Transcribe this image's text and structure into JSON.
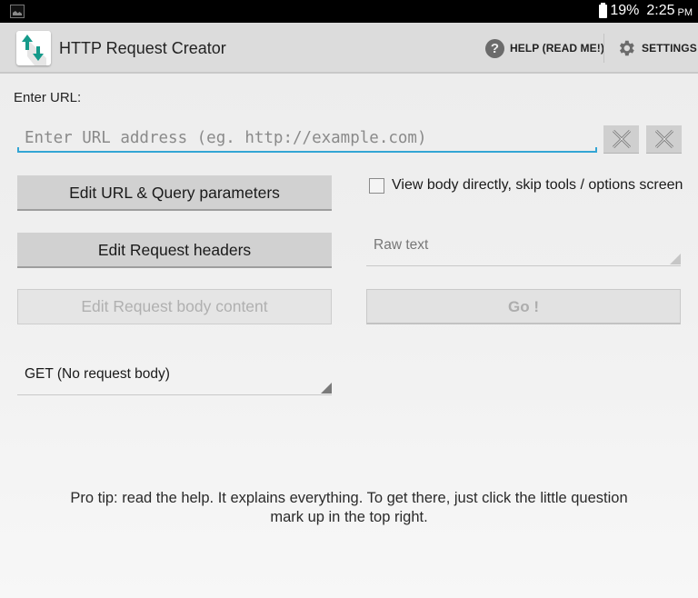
{
  "status_bar": {
    "notification_icon": "gallery-icon",
    "battery_icon": "battery-icon",
    "battery_percent": "19%",
    "time": "2:25",
    "ampm": "PM"
  },
  "action_bar": {
    "app_icon": "up-down-arrows-icon",
    "title": "HTTP Request Creator",
    "help": {
      "icon": "help-circle-icon",
      "label": "HELP (READ ME!)"
    },
    "settings": {
      "icon": "gear-icon",
      "label": "SETTINGS"
    }
  },
  "url": {
    "label": "Enter URL:",
    "value": "",
    "placeholder": "Enter URL address (eg. http://example.com)",
    "clear_buttons": [
      {
        "icon": "close-x-icon"
      },
      {
        "icon": "close-x-icon"
      }
    ]
  },
  "buttons": {
    "edit_url": "Edit URL & Query parameters",
    "edit_headers": "Edit Request headers",
    "edit_body": "Edit Request body content",
    "go": "Go !"
  },
  "options": {
    "skip_tools_label": "View body directly, skip tools / options screen",
    "skip_tools_checked": false,
    "body_type_selected": "Raw text",
    "method_selected": "GET (No request body)"
  },
  "pro_tip": "Pro tip: read the help. It explains everything. To get there, just click the little question mark up in the top right.",
  "colors": {
    "accent_teal": "#159a8a",
    "input_underline": "#33a5d4"
  }
}
